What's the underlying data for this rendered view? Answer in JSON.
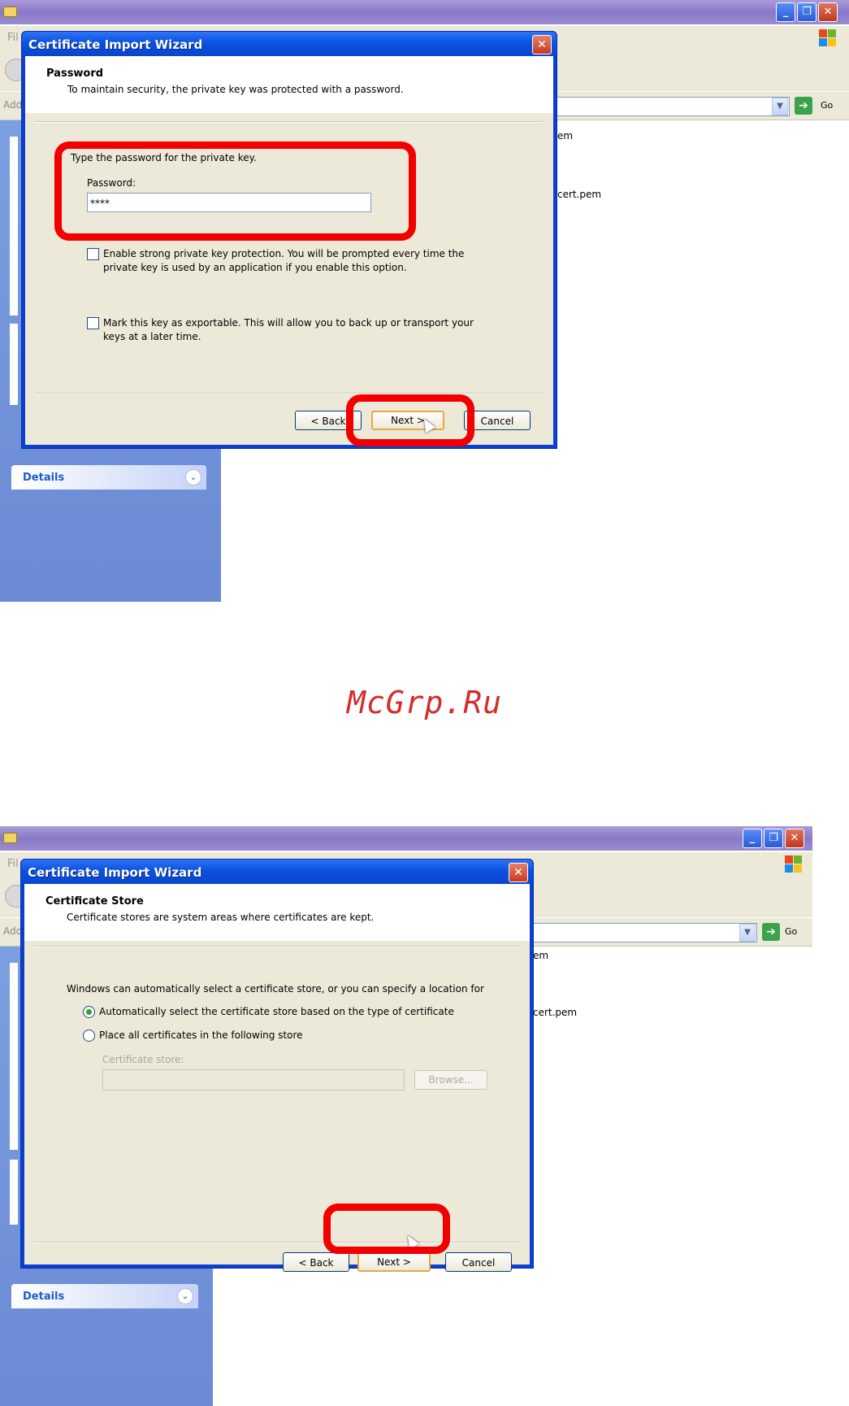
{
  "watermark": "McGrp.Ru",
  "screenshot_1": {
    "window": {
      "menu_partial": "Fil",
      "address_partial": "Add",
      "go_label": "Go",
      "files": [
        "em",
        "cert.pem"
      ]
    },
    "dialog": {
      "title": "Certificate Import Wizard",
      "header_title": "Password",
      "header_subtitle": "To maintain security, the private key was protected with a password.",
      "instruction": "Type the password for the private key.",
      "password_label": "Password:",
      "password_value": "****",
      "option1_line1": "Enable strong private key protection. You will be prompted every time the",
      "option1_line2": "private key is used by an application if you enable this option.",
      "option2_line1": "Mark this key as exportable. This will allow you to back up or transport your",
      "option2_line2": "keys at a later time.",
      "back_label": "< Back",
      "next_label": "Next >",
      "cancel_label": "Cancel"
    },
    "taskpane": {
      "details_label": "Details"
    }
  },
  "screenshot_2": {
    "window": {
      "menu_partial": "Fil",
      "address_partial": "Add",
      "go_label": "Go",
      "files": [
        "em",
        "cert.pem"
      ]
    },
    "dialog": {
      "title": "Certificate Import Wizard",
      "header_title": "Certificate Store",
      "header_subtitle": "Certificate stores are system areas where certificates are kept.",
      "instruction": "Windows can automatically select a certificate store, or you can specify a location for",
      "radio_auto": "Automatically select the certificate store based on the type of certificate",
      "radio_manual": "Place all certificates in the following store",
      "store_label": "Certificate store:",
      "browse_label": "Browse...",
      "back_label": "< Back",
      "next_label": "Next >",
      "cancel_label": "Cancel"
    },
    "taskpane": {
      "details_label": "Details"
    }
  }
}
